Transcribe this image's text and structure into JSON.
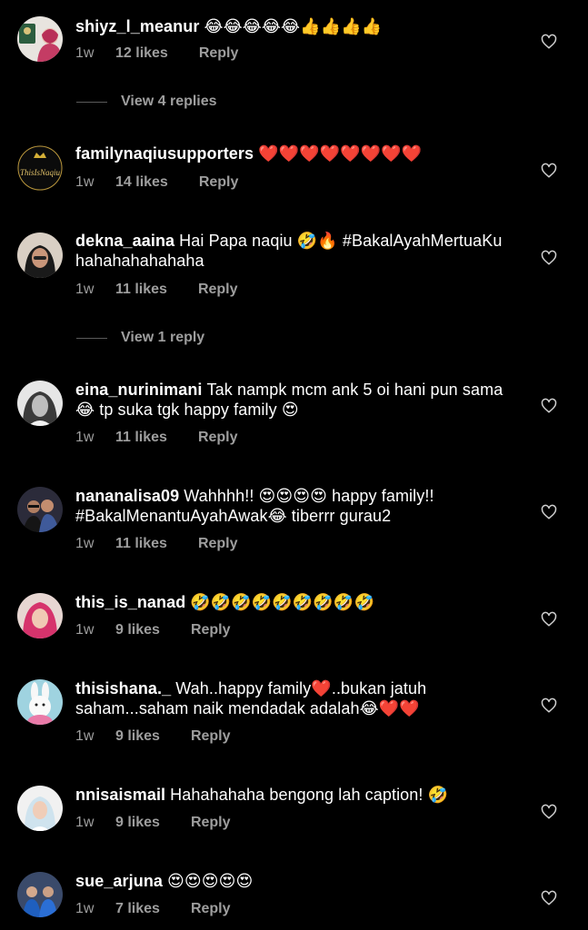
{
  "comments": [
    {
      "username": "shiyz_l_meanur",
      "text": "😂😂😂😂😂👍👍👍👍",
      "time": "1w",
      "likes": "12 likes",
      "reply": "Reply"
    },
    {
      "username": "familynaqiusupporters",
      "text": "❤️❤️❤️❤️❤️❤️❤️❤️",
      "time": "1w",
      "likes": "14 likes",
      "reply": "Reply"
    },
    {
      "username": "dekna_aaina",
      "text": "Hai Papa naqiu 🤣🔥 #BakalAyahMertuaKu hahahahahahaha",
      "time": "1w",
      "likes": "11 likes",
      "reply": "Reply"
    },
    {
      "username": "eina_nurinimani",
      "text": "Tak nampk mcm ank 5 oi hani pun sama 😂 tp suka tgk happy family 😍",
      "time": "1w",
      "likes": "11 likes",
      "reply": "Reply"
    },
    {
      "username": "nananalisa09",
      "text": "Wahhhh!! 😍😍😍😍 happy family!! #BakalMenantuAyahAwak😂 tiberrr gurau2",
      "time": "1w",
      "likes": "11 likes",
      "reply": "Reply"
    },
    {
      "username": "this_is_nanad",
      "text": "🤣🤣🤣🤣🤣🤣🤣🤣🤣",
      "time": "1w",
      "likes": "9 likes",
      "reply": "Reply"
    },
    {
      "username": "thisishana._",
      "text": "Wah..happy family❤️..bukan jatuh saham...saham naik mendadak adalah😂❤️❤️",
      "time": "1w",
      "likes": "9 likes",
      "reply": "Reply"
    },
    {
      "username": "nnisaismail",
      "text": "Hahahahaha bengong lah caption! 🤣",
      "time": "1w",
      "likes": "9 likes",
      "reply": "Reply"
    },
    {
      "username": "sue_arjuna",
      "text": "😍😍😍😍😍",
      "time": "1w",
      "likes": "7 likes",
      "reply": "Reply"
    }
  ],
  "view_replies": [
    {
      "label": "View 4 replies"
    },
    {
      "label": "View 1 reply"
    }
  ],
  "avatar_logos": {
    "familynaqiusupporters": "ThisIsNaqiu"
  },
  "icons": {
    "like": "heart-outline-icon"
  },
  "colors": {
    "background": "#000000",
    "text": "#ffffff",
    "secondary": "#9e9e9e"
  }
}
